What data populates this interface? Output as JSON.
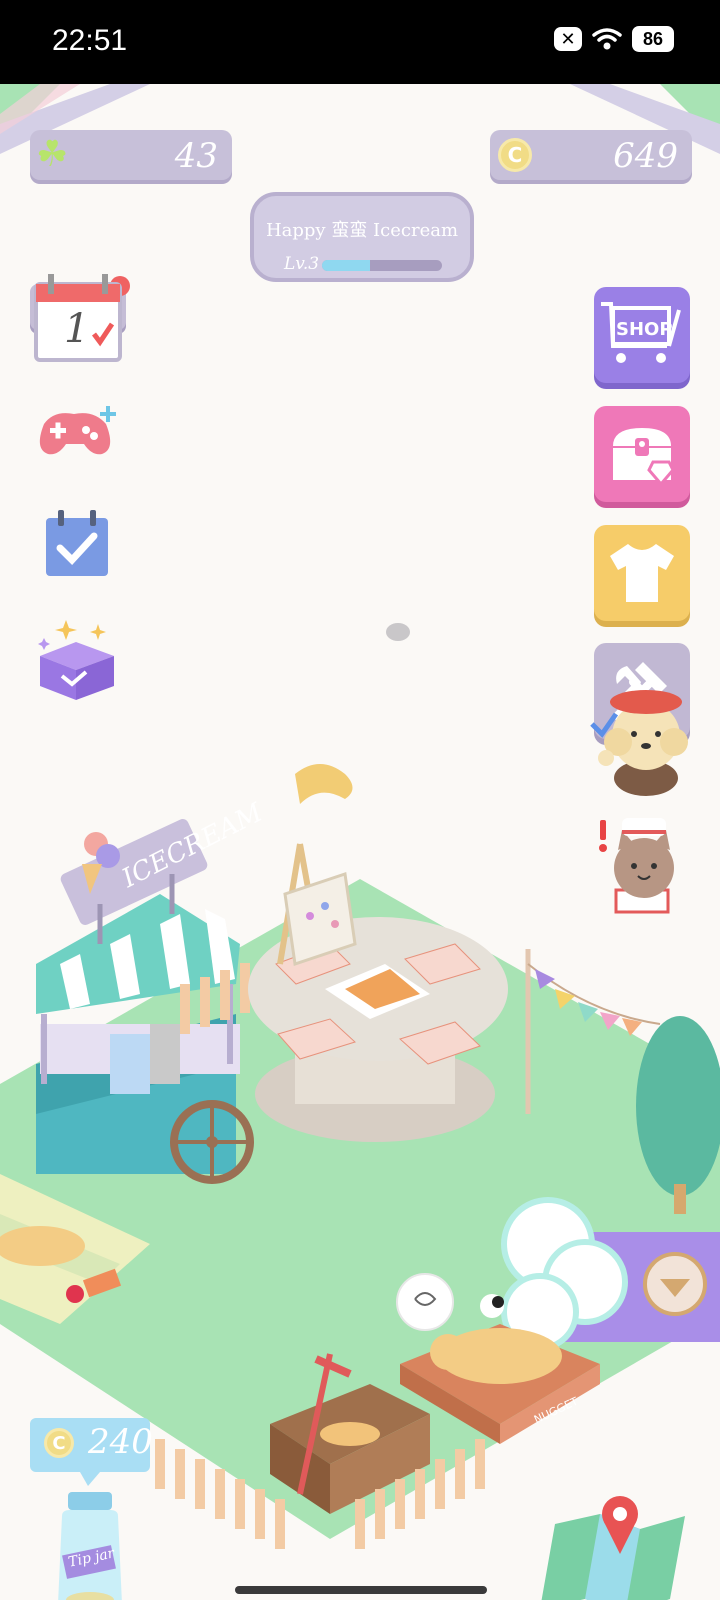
{
  "status_bar": {
    "time": "22:51",
    "battery": "86",
    "icons": [
      "notification-off-icon",
      "wifi-icon",
      "battery-icon"
    ]
  },
  "hud": {
    "clover_count": "43",
    "coin_count": "649",
    "player_name": "Happy 蛮蛮 Icecream",
    "level_label": "Lv.3",
    "level_progress": 0.4
  },
  "right_menu": {
    "shop_label": "SHOP",
    "buttons": [
      "shop",
      "treasure-chest",
      "wardrobe",
      "build-tools"
    ]
  },
  "left_menu": {
    "calendar_day": "1",
    "buttons": [
      "daily-checkin",
      "mini-games",
      "tasks",
      "gift-box"
    ]
  },
  "scene": {
    "cart_sign": "ICECREAM",
    "bed_label": "NUGGET"
  },
  "tip_jar": {
    "coins": "240",
    "jar_label": "Tip jar"
  },
  "colors": {
    "grass": "#a8e3b4",
    "hud_panel": "#c7c0d9",
    "shop_button": "#9a80e6",
    "chest_button": "#ef78b8",
    "shirt_button": "#f6cc69",
    "tools_button": "#c1b8d3"
  }
}
